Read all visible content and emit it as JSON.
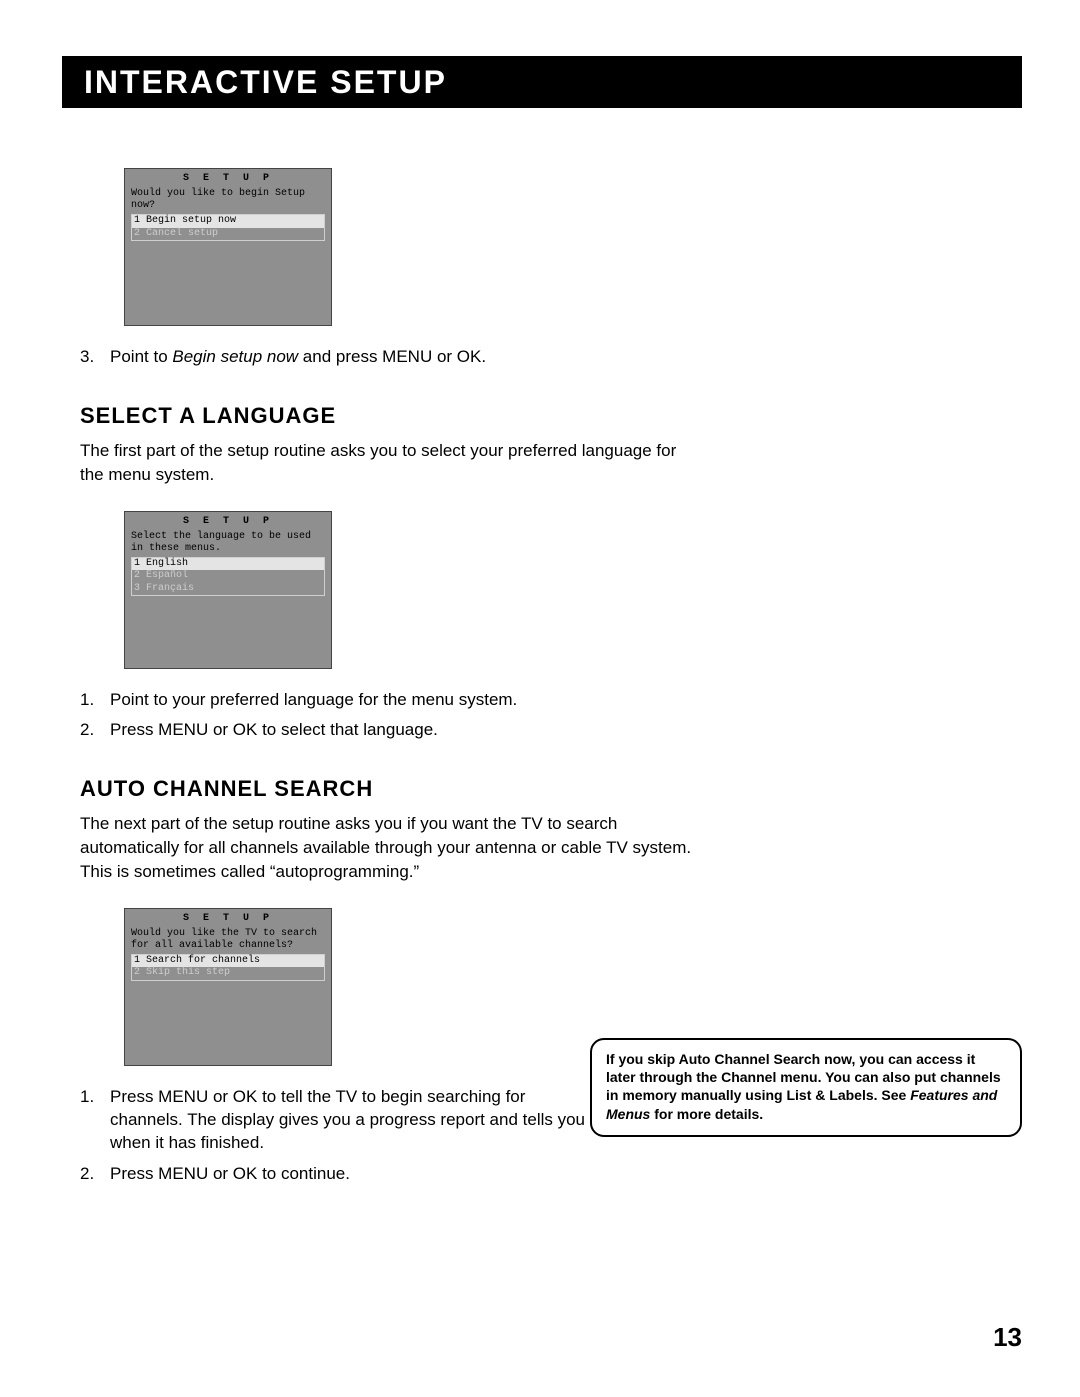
{
  "title": "Interactive Setup",
  "screen1": {
    "header": "S E T U P",
    "prompt": "Would you like to begin Setup now?",
    "options": [
      {
        "num": "1",
        "label": "Begin setup now",
        "selected": true
      },
      {
        "num": "2",
        "label": "Cancel setup",
        "selected": false
      }
    ]
  },
  "step_after_screen1": {
    "num": "3.",
    "text_before_italic": "Point to ",
    "italic": "Begin setup now",
    "text_after_italic": " and press MENU or OK."
  },
  "section_language": {
    "heading": "Select a Language",
    "body": "The first part of the setup routine asks you to select your preferred language for the menu system."
  },
  "screen2": {
    "header": "S E T U P",
    "prompt": "Select the language to be used in these menus.",
    "options": [
      {
        "num": "1",
        "label": "English",
        "selected": true
      },
      {
        "num": "2",
        "label": "Español",
        "selected": false
      },
      {
        "num": "3",
        "label": "Français",
        "selected": false
      }
    ]
  },
  "steps_language": [
    {
      "num": "1.",
      "text": "Point to your preferred language for the menu system."
    },
    {
      "num": "2.",
      "text": "Press MENU or OK to select that language."
    }
  ],
  "section_auto": {
    "heading": "Auto Channel Search",
    "body": "The next part of the setup routine asks you if you want the TV to search automatically for all channels available through your antenna or cable TV system. This is sometimes called “autoprogramming.”"
  },
  "screen3": {
    "header": "S E T U P",
    "prompt": "Would you like the TV to search for all available channels?",
    "options": [
      {
        "num": "1",
        "label": "Search for channels",
        "selected": true
      },
      {
        "num": "2",
        "label": "Skip this step",
        "selected": false
      }
    ]
  },
  "steps_auto": [
    {
      "num": "1.",
      "text": "Press MENU or OK to tell the TV to begin searching for channels. The display gives you a progress report and tells you when it has finished."
    },
    {
      "num": "2.",
      "text": "Press MENU or OK to continue."
    }
  ],
  "note": {
    "bold1": "If you skip Auto Channel Search now, you can access it later through the Channel menu. You can also put channels in memory manually using List & Labels. See ",
    "italic": "Features and Menus",
    "bold2": " for more details."
  },
  "page_number": "13"
}
